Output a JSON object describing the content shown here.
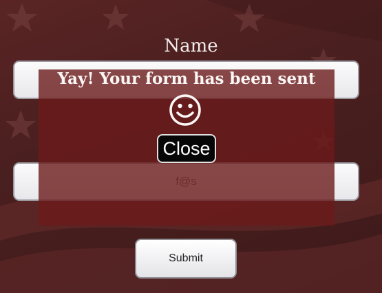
{
  "form": {
    "name_label": "Name",
    "email_value": "f@s",
    "submit_label": "Submit"
  },
  "modal": {
    "message": "Yay! Your form has been sent",
    "icon": "smiley-face-icon",
    "close_label": "Close"
  },
  "colors": {
    "background": "#4a1f1f",
    "overlay": "#6c1a1a",
    "close_button": "#070707"
  }
}
